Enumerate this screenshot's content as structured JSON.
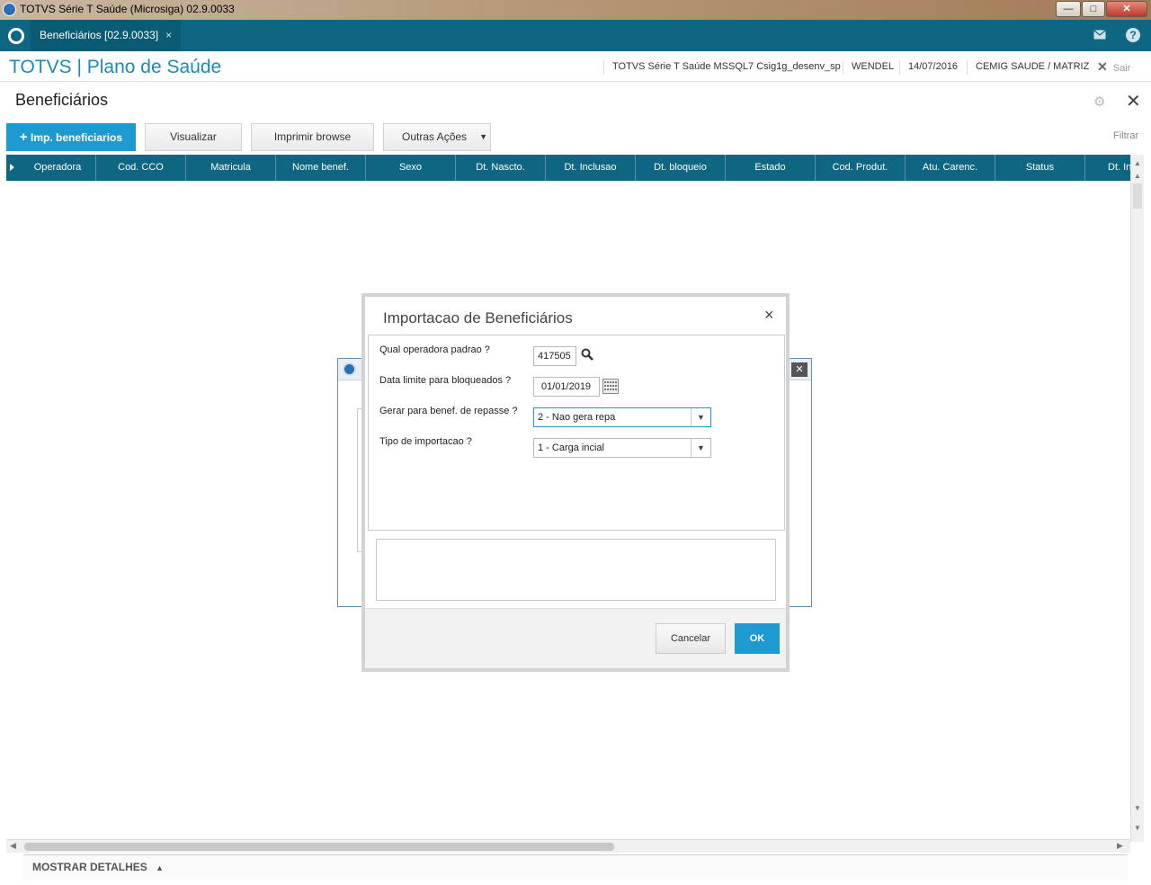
{
  "window": {
    "title": "TOTVS Série T Saúde (Microsiga) 02.9.0033",
    "minimize": "—",
    "maximize": "□",
    "close": "✕"
  },
  "tabbar": {
    "tab_label": "Beneficiários [02.9.0033]",
    "tab_close": "×",
    "mail_icon": "mail-icon",
    "help_icon": "help-icon"
  },
  "header": {
    "brand": "TOTVS | Plano de Saúde",
    "environment": "TOTVS Série T Saúde MSSQL7 Csig1g_desenv_sp",
    "user": "WENDEL",
    "date": "14/07/2016",
    "company": "CEMIG SAUDE / MATRIZ",
    "logout": "Sair"
  },
  "page": {
    "title": "Beneficiários"
  },
  "toolbar": {
    "import_label": "Imp. beneficiarios",
    "view_label": "Visualizar",
    "print_label": "Imprimir browse",
    "more_label": "Outras Ações",
    "filter_label": "Filtrar"
  },
  "grid": {
    "columns": [
      "Operadora",
      "Cod. CCO",
      "Matricula",
      "Nome benef.",
      "Sexo",
      "Dt. Nascto.",
      "Dt. Inclusao",
      "Dt. bloqueio",
      "Estado",
      "Cod. Produt.",
      "Atu. Carenc.",
      "Status",
      "Dt. In"
    ]
  },
  "details": {
    "label": "MOSTRAR DETALHES"
  },
  "dialog": {
    "title": "Importacao de Beneficiários",
    "close": "×",
    "fields": {
      "operadora_label": "Qual operadora padrao ?",
      "operadora_value": "417505",
      "data_label": "Data limite para bloqueados ?",
      "data_value": "01/01/2019",
      "repasse_label": "Gerar para benef. de repasse ?",
      "repasse_value": "2 - Nao gera repa",
      "tipo_label": "Tipo de importacao ?",
      "tipo_value": "1 - Carga incial"
    },
    "cancel_label": "Cancelar",
    "ok_label": "OK"
  },
  "colors": {
    "accent": "#1d9bd0",
    "bar": "#0e6682",
    "brand": "#1c8bb0"
  }
}
